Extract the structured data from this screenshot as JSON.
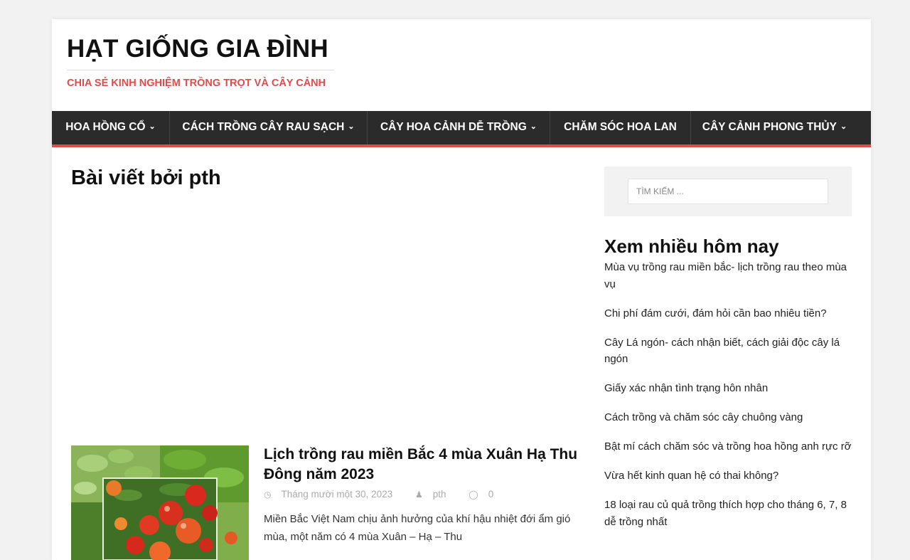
{
  "site": {
    "title": "HẠT GIỐNG GIA ĐÌNH",
    "tagline": "CHIA SẺ KINH NGHIỆM TRỒNG TRỌT VÀ CÂY CẢNH"
  },
  "nav": {
    "items": [
      {
        "label": "HOA HỒNG CỔ",
        "dropdown": true
      },
      {
        "label": "CÁCH TRỒNG CÂY RAU SẠCH",
        "dropdown": true
      },
      {
        "label": "CÂY HOA CẢNH DỄ TRỒNG",
        "dropdown": true
      },
      {
        "label": "CHĂM SÓC HOA LAN",
        "dropdown": false
      },
      {
        "label": "CÂY CẢNH PHONG THỦY",
        "dropdown": true
      }
    ],
    "chevron": "⌄"
  },
  "archive": {
    "title": "Bài viết bởi pth"
  },
  "post": {
    "title": "Lịch trồng rau miền Bắc 4 mùa Xuân Hạ Thu Đông năm 2023",
    "date": "Tháng mười một 30, 2023",
    "author": "pth",
    "comments": "0",
    "excerpt": "Miền Bắc Việt Nam chịu ảnh hưởng của khí hậu nhiệt đới ẩm gió mùa, một năm có 4 mùa Xuân – Hạ – Thu"
  },
  "sidebar": {
    "search_placeholder": "TÌM KIẾM ...",
    "popular_title": "Xem nhiều hôm nay",
    "popular_items": [
      "Mùa vụ trồng rau miền bắc- lịch trồng rau theo mùa vụ",
      "Chi phí đám cưới, đám hỏi cần bao nhiêu tiền?",
      "Cây Lá ngón- cách nhận biết, cách giải độc cây lá ngón",
      "Giấy xác nhận tình trạng hôn nhân",
      "Cách trồng và chăm sóc cây chuông vàng",
      "Bật mí cách chăm sóc và trồng hoa hồng anh rực rỡ",
      "Vừa hết kinh quan hệ có thai không?",
      "18 loại rau củ quả trồng thích hợp cho tháng 6, 7, 8 dễ trồng nhất"
    ]
  },
  "icons": {
    "clock": "clock-icon",
    "user": "user-icon",
    "comment": "comment-icon"
  },
  "colors": {
    "accent": "#e04b4b",
    "nav_bg": "#2b2b2b",
    "page_bg": "#f2f2f2"
  }
}
